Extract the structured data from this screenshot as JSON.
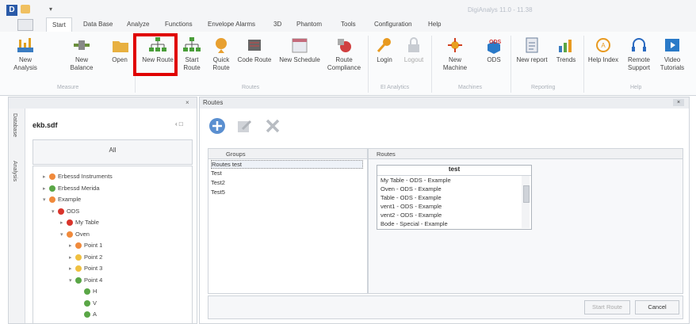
{
  "app": {
    "logo": "D",
    "window_title": "DigiAnalys 11.0  -  11.38"
  },
  "menu": {
    "tabs": [
      "Start",
      "Data Base",
      "Analyze",
      "Functions",
      "Envelope Alarms",
      "3D",
      "Phantom",
      "Tools",
      "Configuration",
      "Help"
    ],
    "active": "Start"
  },
  "ribbon": {
    "buttons": [
      {
        "label": "New Analysis",
        "icon": "new-analysis-icon"
      },
      {
        "label": "New Balance",
        "icon": "new-balance-icon"
      },
      {
        "label": "Open",
        "icon": "open-folder-icon"
      },
      {
        "label": "New Route",
        "icon": "new-route-icon"
      },
      {
        "label": "Start Route",
        "icon": "start-route-icon"
      },
      {
        "label": "Quick Route",
        "icon": "quick-route-icon"
      },
      {
        "label": "Code Route",
        "icon": "code-route-icon"
      },
      {
        "label": "New Schedule",
        "icon": "calendar-icon"
      },
      {
        "label": "Route Compliance",
        "icon": "route-compliance-icon"
      },
      {
        "label": "Login",
        "icon": "key-icon"
      },
      {
        "label": "Logout",
        "icon": "lock-icon"
      },
      {
        "label": "New Machine",
        "icon": "new-machine-icon"
      },
      {
        "label": "ODS",
        "icon": "ods-cube-icon"
      },
      {
        "label": "New report",
        "icon": "report-icon"
      },
      {
        "label": "Trends",
        "icon": "trends-icon"
      },
      {
        "label": "Help Index",
        "icon": "help-index-icon"
      },
      {
        "label": "Remote Support",
        "icon": "headset-icon"
      },
      {
        "label": "Video Tutorials",
        "icon": "video-icon"
      }
    ],
    "groups": [
      "Measure",
      "Routes",
      "EI Analytics",
      "Machines",
      "Reporting",
      "Help"
    ],
    "ods_tag": "ODS"
  },
  "left_panel": {
    "vertical_tabs": [
      "Database",
      "Analysis"
    ],
    "db_name": "ekb.sdf",
    "db_controls": "‹  □",
    "filter_label": "All",
    "tree": [
      {
        "label": "Erbessd Instruments",
        "level": 0,
        "color": "#f08a3c",
        "tw": "▸"
      },
      {
        "label": "Erbessd Merida",
        "level": 0,
        "color": "#5aa646",
        "tw": "▸"
      },
      {
        "label": "Example",
        "level": 0,
        "color": "#f08a3c",
        "tw": "▾"
      },
      {
        "label": "ODS",
        "level": 1,
        "color": "#d9342b",
        "tw": "▾"
      },
      {
        "label": "My Table",
        "level": 2,
        "color": "#d9342b",
        "tw": "▸"
      },
      {
        "label": "Oven",
        "level": 2,
        "color": "#f08a3c",
        "tw": "▾"
      },
      {
        "label": "Point 1",
        "level": 3,
        "color": "#f08a3c",
        "tw": "▸"
      },
      {
        "label": "Point 2",
        "level": 3,
        "color": "#f0c040",
        "tw": "▸"
      },
      {
        "label": "Point 3",
        "level": 3,
        "color": "#f0c040",
        "tw": "▸"
      },
      {
        "label": "Point 4",
        "level": 3,
        "color": "#5aa646",
        "tw": "▾"
      },
      {
        "label": "H",
        "level": 4,
        "color": "#5aa646",
        "tw": ""
      },
      {
        "label": "V",
        "level": 4,
        "color": "#5aa646",
        "tw": ""
      },
      {
        "label": "A",
        "level": 4,
        "color": "#5aa646",
        "tw": ""
      }
    ]
  },
  "routes_panel": {
    "title": "Routes",
    "close_label": "×",
    "groups_header": "Groups",
    "groups": [
      "Routes test",
      "Test",
      "Test2",
      "Test5"
    ],
    "routes_header": "Routes",
    "list_title": "test",
    "routes": [
      "My Table - ODS - Example",
      "Oven - ODS - Example",
      "Table - ODS - Example",
      "vent1 - ODS - Example",
      "vent2 - ODS - Example",
      "Bode - Special - Example"
    ],
    "start_route_label": "Start Route",
    "cancel_label": "Cancel"
  }
}
